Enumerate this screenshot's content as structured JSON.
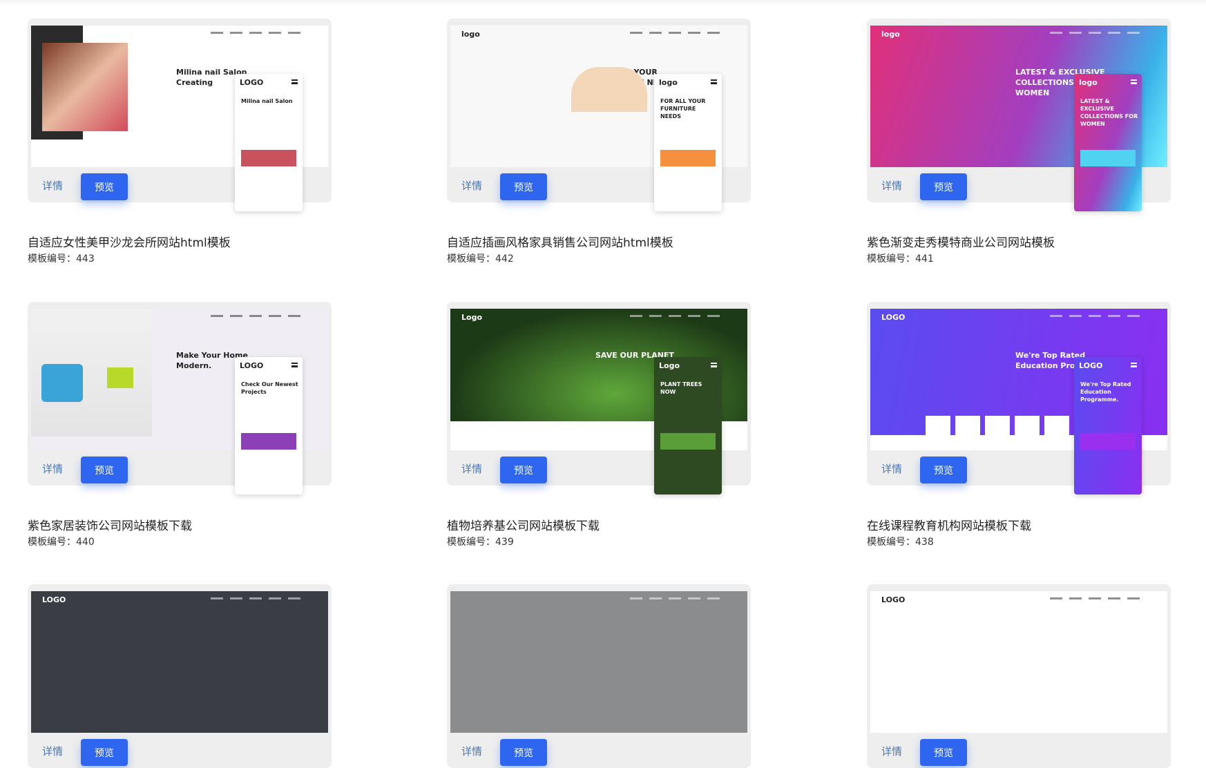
{
  "detail_label": "详情",
  "preview_label": "预览",
  "code_prefix": "模板编号：",
  "templates": [
    {
      "title": "自适应女性美甲沙龙会所网站html模板",
      "code": "443",
      "logo": "LOGO",
      "headline": "Milina nail Salon Creating",
      "mobile_headline": "Milina nail Salon",
      "bg": "#ffffff",
      "fg": "#222222",
      "accent": "#c8525e"
    },
    {
      "title": "自适应插画风格家具销售公司网站html模板",
      "code": "442",
      "logo": "logo",
      "headline": "FOR ALL YOUR FURNITURE NEEDS",
      "mobile_headline": "FOR ALL YOUR FURNITURE NEEDS",
      "bg": "#f8f8f8",
      "fg": "#222222",
      "accent": "#f5913e"
    },
    {
      "title": "紫色渐变走秀模特商业公司网站模板",
      "code": "441",
      "logo": "logo",
      "headline": "LATEST & EXCLUSIVE COLLECTIONS FOR WOMEN",
      "mobile_headline": "LATEST & EXCLUSIVE COLLECTIONS FOR WOMEN",
      "bg": "#d5307f",
      "fg": "#ffffff",
      "accent": "#4fd3f0"
    },
    {
      "title": "紫色家居装饰公司网站模板下载",
      "code": "440",
      "logo": "LOGO",
      "headline": "Make Your Home Modern.",
      "mobile_headline": "Check Our Newest Projects",
      "bg": "#f1edf5",
      "fg": "#222222",
      "accent": "#8d3fb8"
    },
    {
      "title": "植物培养基公司网站模板下载",
      "code": "439",
      "logo": "Logo",
      "headline": "SAVE OUR PLANET",
      "mobile_headline": "PLANT TREES NOW",
      "bg": "#1e3a1a",
      "fg": "#ffffff",
      "accent": "#5a9e3a"
    },
    {
      "title": "在线课程教育机构网站模板下载",
      "code": "438",
      "logo": "LOGO",
      "headline": "We're Top Rated Education Programme.",
      "mobile_headline": "We're Top Rated Education Programme.",
      "bg": "#6a3df0",
      "fg": "#ffffff",
      "accent": "#9a2ff0"
    },
    {
      "title": "",
      "code": "",
      "logo": "LOGO",
      "headline": "",
      "mobile_headline": "",
      "bg": "#3a3d44",
      "fg": "#ffffff",
      "accent": "#555"
    },
    {
      "title": "",
      "code": "",
      "logo": "",
      "headline": "",
      "mobile_headline": "",
      "bg": "#8a8c8e",
      "fg": "#ffffff",
      "accent": "#555"
    },
    {
      "title": "",
      "code": "",
      "logo": "LOGO",
      "headline": "",
      "mobile_headline": "",
      "bg": "#ffffff",
      "fg": "#222222",
      "accent": "#c8a070"
    }
  ]
}
